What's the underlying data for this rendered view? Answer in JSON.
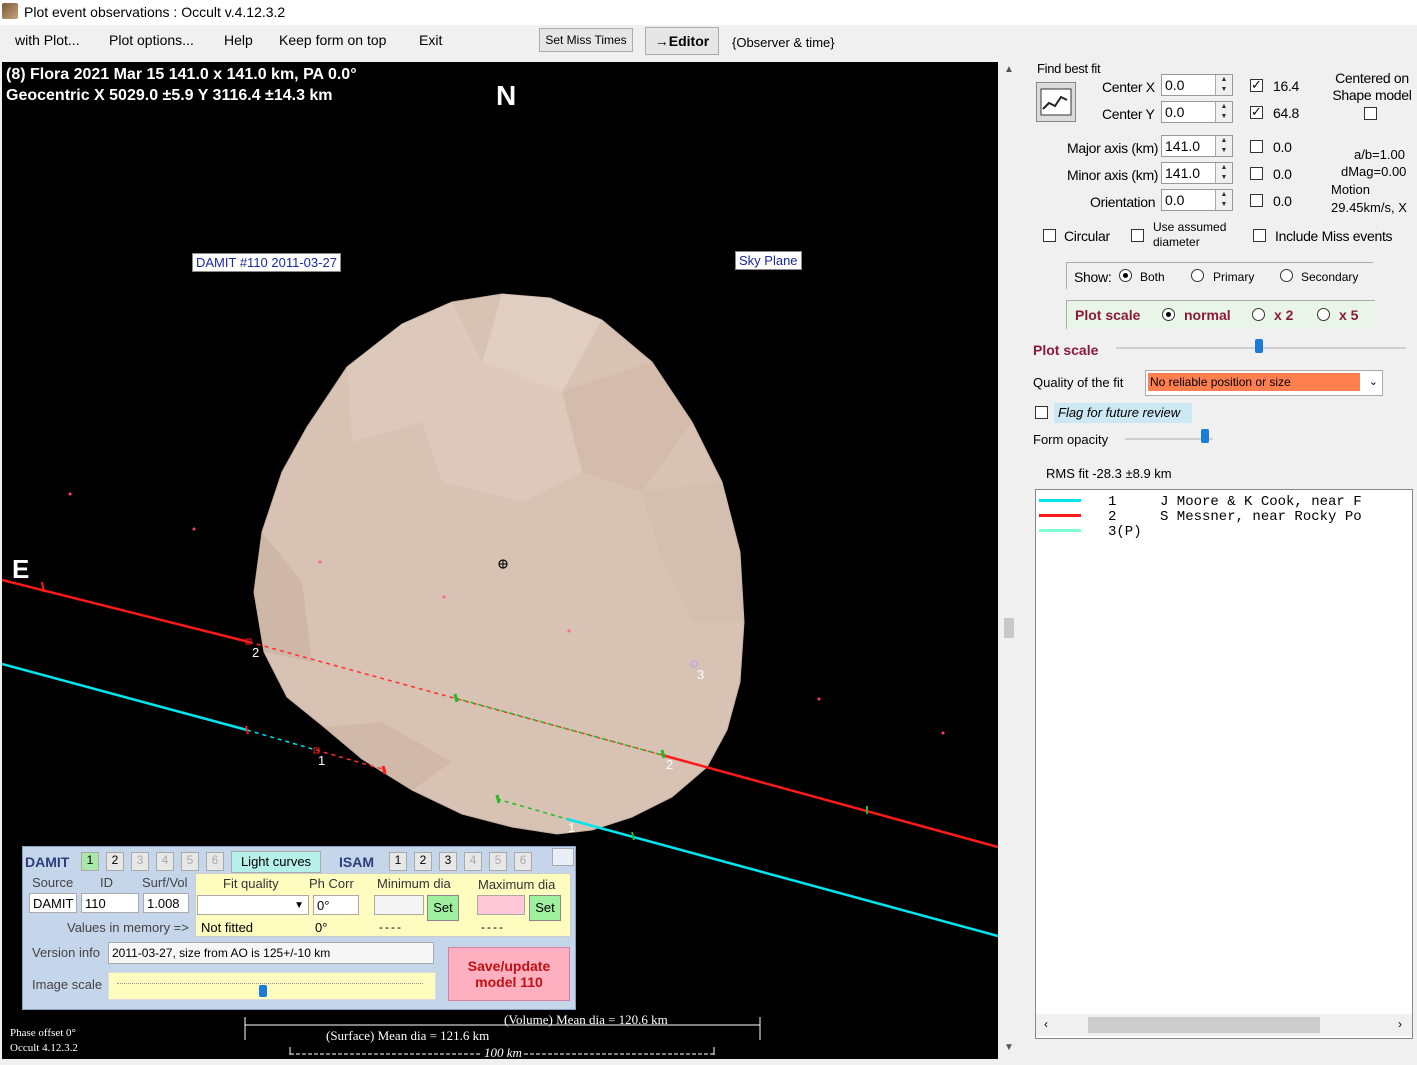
{
  "window": {
    "title": "Plot event observations : Occult v.4.12.3.2"
  },
  "menu": {
    "items": [
      "with Plot...",
      "Plot options...",
      "Help",
      "Keep form on top",
      "Exit"
    ],
    "set_miss_times": "Set Miss Times",
    "editor": "→Editor",
    "observer_time": "{Observer & time}"
  },
  "plot": {
    "header_line1": "(8) Flora  2021 Mar 15   141.0 x 141.0 km, PA 0.0°",
    "header_line2": "Geocentric  X  5029.0 ±5.9  Y 3116.4 ±14.3 km",
    "north": "N",
    "east": "E",
    "damit_label": "DAMIT #110 2011-03-27",
    "sky_plane": "Sky Plane",
    "chord_labels": [
      "2",
      "1",
      "2",
      "1",
      "3"
    ],
    "volume_dia": "(Volume) Mean dia = 120.6 km",
    "surface_dia": "(Surface) Mean dia = 121.6 km",
    "scale": "100 km",
    "phase_offset": "Phase offset 0°",
    "version": "Occult 4.12.3.2",
    "colors": {
      "chord1": "#00e5ee",
      "chord2": "#ff1a1a",
      "asteroid": "#d9c3b3"
    }
  },
  "damit_panel": {
    "damit_label": "DAMIT",
    "damit_numbers": [
      "1",
      "2",
      "3",
      "4",
      "5",
      "6"
    ],
    "light_curves": "Light curves",
    "isam_label": "ISAM",
    "isam_numbers": [
      "1",
      "2",
      "3",
      "4",
      "5",
      "6"
    ],
    "headers": {
      "source": "Source",
      "id": "ID",
      "surf_vol": "Surf/Vol",
      "fit_quality": "Fit quality",
      "ph_corr": "Ph Corr",
      "min_dia": "Minimum dia",
      "max_dia": "Maximum dia"
    },
    "source": "DAMIT",
    "id": "110",
    "surf_vol": "1.008",
    "ph_corr_value": "0°",
    "set_label": "Set",
    "values_in_memory": "Values in memory =>",
    "not_fitted": "Not fitted",
    "ph_mem": "0°",
    "dashes": "----",
    "version_info_label": "Version info",
    "version_info": "2011-03-27, size from AO is 125+/-10 km",
    "image_scale_label": "Image scale",
    "save_button": "Save/update model 110"
  },
  "right_panel": {
    "find_best_fit": "Find best fit",
    "center_x_label": "Center X",
    "center_x": "0.0",
    "center_y_label": "Center Y",
    "center_y": "0.0",
    "major_label": "Major axis (km)",
    "major": "141.0",
    "minor_label": "Minor axis (km)",
    "minor": "141.0",
    "orientation_label": "Orientation",
    "orientation": "0.0",
    "fit_values": [
      "16.4",
      "64.8",
      "0.0",
      "0.0",
      "0.0"
    ],
    "centered_on": "Centered on Shape model",
    "ab_ratio": "a/b=1.00",
    "dmag": "dMag=0.00",
    "motion_label": "Motion",
    "motion": "29.45km/s, X",
    "circular": "Circular",
    "use_assumed": "Use assumed diameter",
    "include_miss": "Include Miss events",
    "show_label": "Show:",
    "show_options": [
      "Both",
      "Primary",
      "Secondary"
    ],
    "plot_scale_label": "Plot scale",
    "scale_options": [
      "normal",
      "x 2",
      "x 5"
    ],
    "plot_scale_slider_label": "Plot scale",
    "quality_label": "Quality of the fit",
    "quality_value": "No reliable position or size",
    "flag_review": "Flag for future review",
    "form_opacity": "Form opacity",
    "rms_fit": "RMS fit -28.3 ±8.9 km"
  },
  "observations": [
    {
      "num": "1",
      "name": "J Moore & K Cook, near F",
      "color": "#00e5ee"
    },
    {
      "num": "2",
      "name": "S Messner, near Rocky Po",
      "color": "#ff1a1a"
    },
    {
      "num": "3(P)",
      "name": "",
      "color": "#7fffd4"
    }
  ]
}
